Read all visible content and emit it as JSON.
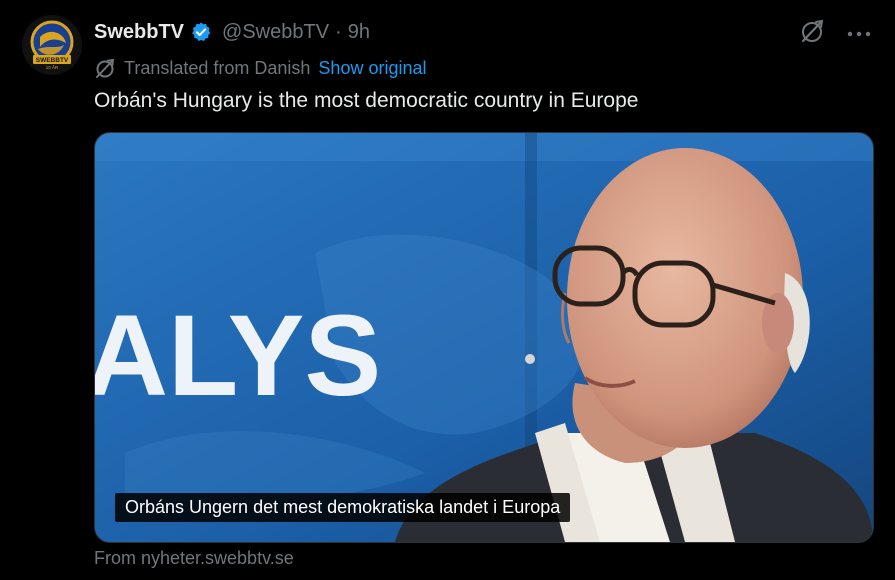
{
  "tweet": {
    "display_name": "SwebbTV",
    "handle": "@SwebbTV",
    "separator": "·",
    "time": "9h",
    "translated_label": "Translated from Danish",
    "show_original": "Show original",
    "text": "Orbán's Hungary is the most democratic country in Europe",
    "media": {
      "background_word": "ALYS",
      "subtitle": "Orbáns Ungern det mest demokratiska landet i Europa"
    },
    "source": "From nyheter.swebbtv.se"
  },
  "avatar": {
    "logo_text": "SWEBBTV",
    "logo_subtext": "10 ÅR"
  },
  "icons": {
    "verified": "verified-badge-icon",
    "grok": "grok-icon",
    "more": "more-icon",
    "translate": "translate-icon"
  },
  "colors": {
    "background": "#000000",
    "text": "#e7e9ea",
    "muted": "#71767b",
    "link": "#1d9bf0",
    "verified": "#1d9bf0",
    "avatar_gold": "#d9a520",
    "avatar_blue": "#1b3f8f"
  }
}
